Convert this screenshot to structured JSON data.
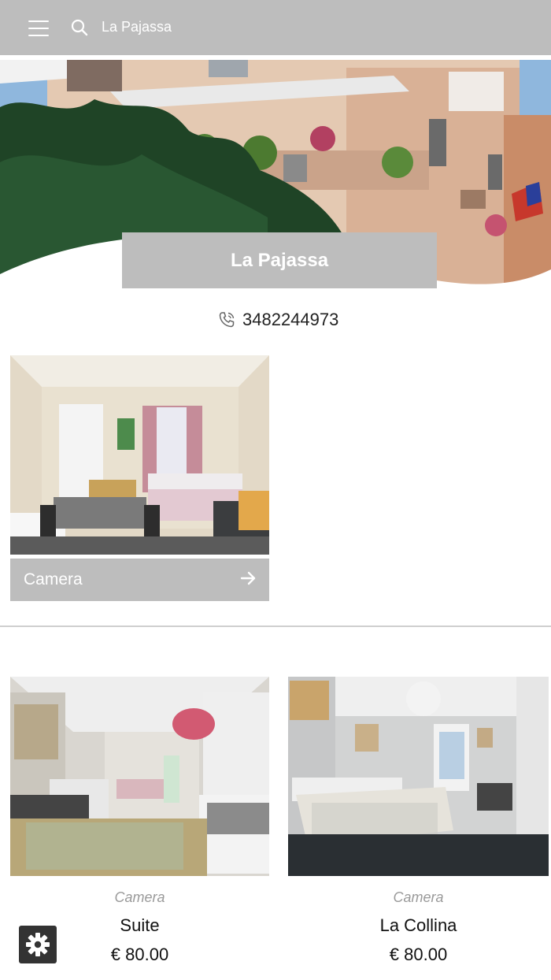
{
  "topbar": {
    "title": "La Pajassa"
  },
  "hero": {
    "title": "La Pajassa"
  },
  "contact": {
    "phone": "3482244973"
  },
  "featured": {
    "label": "Camera"
  },
  "rooms": [
    {
      "category": "Camera",
      "name": "Suite",
      "price": "€ 80.00"
    },
    {
      "category": "Camera",
      "name": "La Collina",
      "price": "€ 80.00"
    }
  ]
}
